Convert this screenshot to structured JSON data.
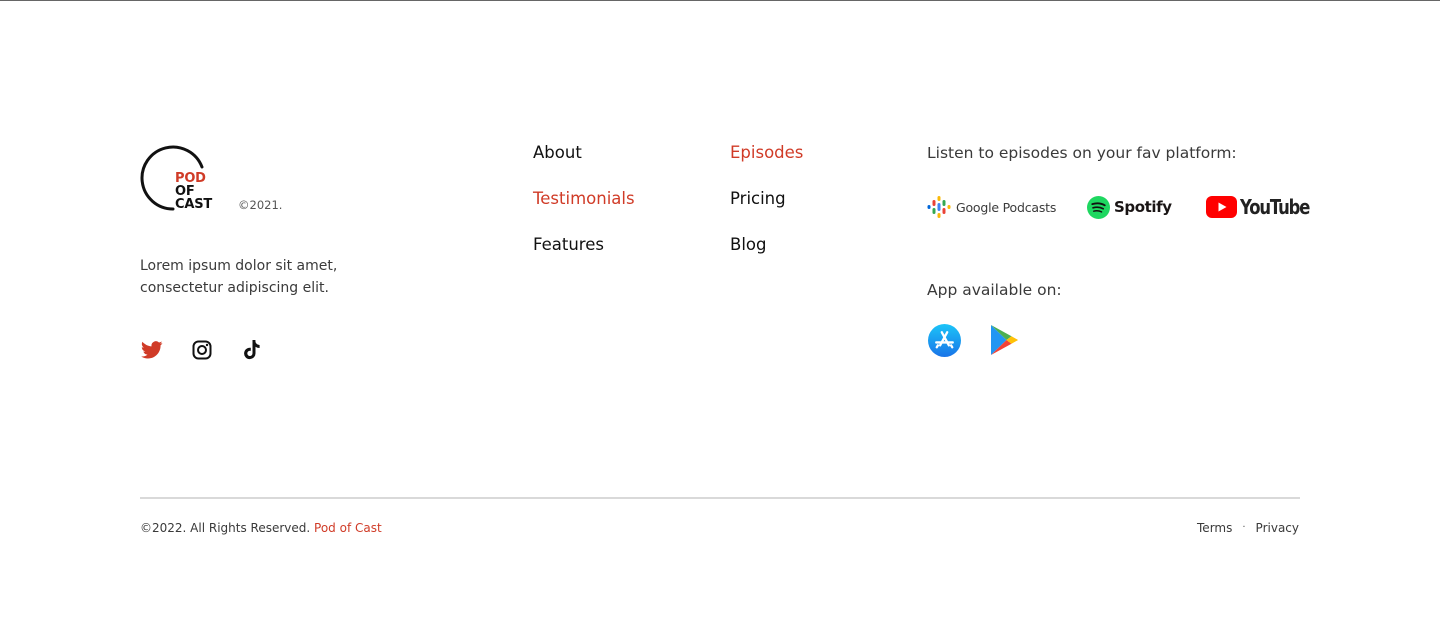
{
  "brand": {
    "logo_lines": [
      "POD",
      "OF",
      "CAST"
    ],
    "year_note": "©2021.",
    "tagline_line1": "Lorem ipsum dolor sit amet,",
    "tagline_line2": "consectetur adipiscing elit.",
    "accent_color": "#d03b27"
  },
  "social": [
    {
      "name": "twitter-icon"
    },
    {
      "name": "instagram-icon"
    },
    {
      "name": "tiktok-icon"
    }
  ],
  "nav": {
    "col1": [
      {
        "label": "About",
        "accent": false
      },
      {
        "label": "Testimonials",
        "accent": true
      },
      {
        "label": "Features",
        "accent": false
      }
    ],
    "col2": [
      {
        "label": "Episodes",
        "accent": true
      },
      {
        "label": "Pricing",
        "accent": false
      },
      {
        "label": "Blog",
        "accent": false
      }
    ]
  },
  "platforms": {
    "heading": "Listen to episodes on your fav platform:",
    "items": [
      {
        "label": "Google Podcasts",
        "icon": "google-podcasts-icon"
      },
      {
        "label": "Spotify",
        "icon": "spotify-icon"
      },
      {
        "label": "YouTube",
        "icon": "youtube-icon"
      }
    ]
  },
  "apps": {
    "heading": "App available on:",
    "items": [
      {
        "icon": "app-store-icon"
      },
      {
        "icon": "google-play-icon"
      }
    ]
  },
  "footer": {
    "copyright": "©2022. All Rights Reserved.",
    "brand_name": "Pod of Cast",
    "terms": "Terms",
    "separator": "·",
    "privacy": "Privacy"
  }
}
